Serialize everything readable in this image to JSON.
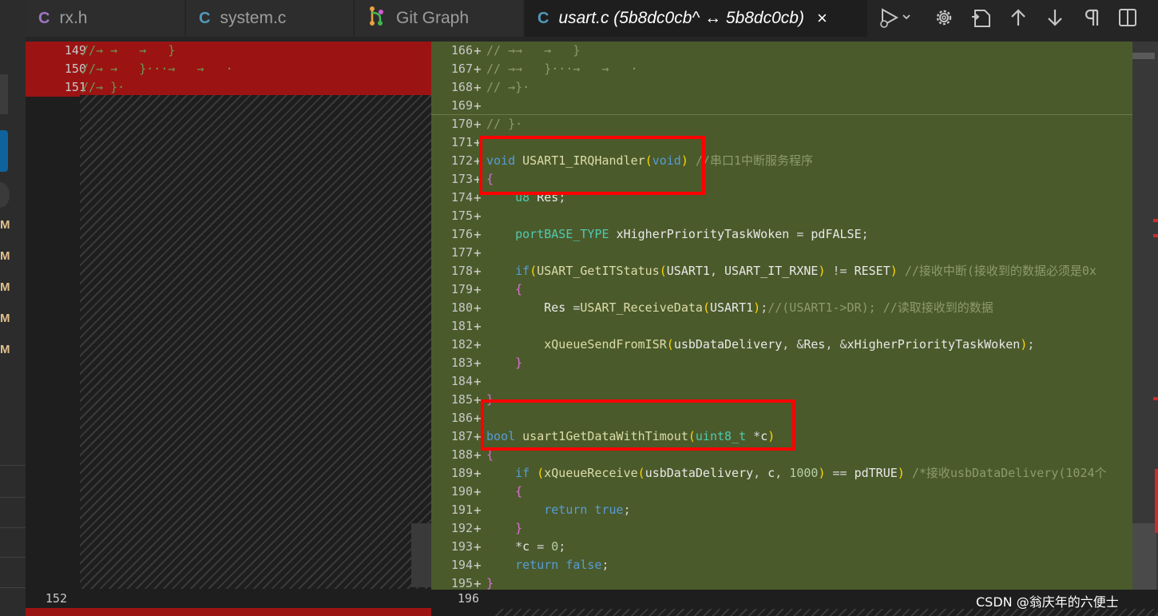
{
  "tabs": [
    {
      "icon": "C",
      "label": "rx.h"
    },
    {
      "icon": "C",
      "label": "system.c"
    },
    {
      "icon": "git-graph-icon",
      "label": "Git Graph"
    },
    {
      "icon": "C",
      "label": "usart.c (5b8dc0cb^ ↔ 5b8dc0cb)",
      "close": "×"
    }
  ],
  "activity_marks": [
    "M",
    "M",
    "M",
    "M",
    "M"
  ],
  "left": {
    "rows": [
      {
        "num": "149",
        "text": "//→ →   →   }"
      },
      {
        "num": "150",
        "text": "//→ →   }···→   →   ·"
      },
      {
        "num": "151",
        "text": "//→ }·"
      }
    ],
    "line_152": "152"
  },
  "right": {
    "line_196": "196",
    "rows": [
      {
        "num": "166",
        "text": "// →→   →   }"
      },
      {
        "num": "167",
        "text": "// →→   }···→   →   ·"
      },
      {
        "num": "168",
        "text": "// →}·"
      },
      {
        "num": "169",
        "text": ""
      },
      {
        "num": "170",
        "text": "// }·"
      },
      {
        "num": "171",
        "text": ""
      },
      {
        "num": "172",
        "code": "void USART1_IRQHandler(void)",
        "comment": "//串口1中断服务程序"
      },
      {
        "num": "173",
        "code": "{"
      },
      {
        "num": "174",
        "code": "    u8 Res;"
      },
      {
        "num": "175",
        "code": ""
      },
      {
        "num": "176",
        "code": "    portBASE_TYPE xHigherPriorityTaskWoken = pdFALSE;"
      },
      {
        "num": "177",
        "code": ""
      },
      {
        "num": "178",
        "code": "    if(USART_GetITStatus(USART1, USART_IT_RXNE) != RESET)",
        "comment": "//接收中断(接收到的数据必须是0x"
      },
      {
        "num": "179",
        "code": "    {"
      },
      {
        "num": "180",
        "code": "        Res =USART_ReceiveData(USART1);//(USART1->DR);",
        "comment": "//读取接收到的数据"
      },
      {
        "num": "181",
        "code": ""
      },
      {
        "num": "182",
        "code": "        xQueueSendFromISR(usbDataDelivery, &Res, &xHigherPriorityTaskWoken);"
      },
      {
        "num": "183",
        "code": "    }"
      },
      {
        "num": "184",
        "code": ""
      },
      {
        "num": "185",
        "code": "}"
      },
      {
        "num": "186",
        "code": ""
      },
      {
        "num": "187",
        "code": "bool usart1GetDataWithTimout(uint8_t *c)"
      },
      {
        "num": "188",
        "code": "{"
      },
      {
        "num": "189",
        "code": "    if (xQueueReceive(usbDataDelivery, c, 1000) == pdTRUE)",
        "comment": "/*接收usbDataDelivery(1024个"
      },
      {
        "num": "190",
        "code": "    {"
      },
      {
        "num": "191",
        "code": "        return true;"
      },
      {
        "num": "192",
        "code": "    }"
      },
      {
        "num": "193",
        "code": "    *c = 0;"
      },
      {
        "num": "194",
        "code": "    return false;"
      },
      {
        "num": "195",
        "code": "}"
      }
    ]
  },
  "watermark": "CSDN @翁庆年的六便士",
  "colors": {
    "deleted": "#9b1413",
    "added": "#4b5a2b",
    "highlight": "#ff0000"
  }
}
